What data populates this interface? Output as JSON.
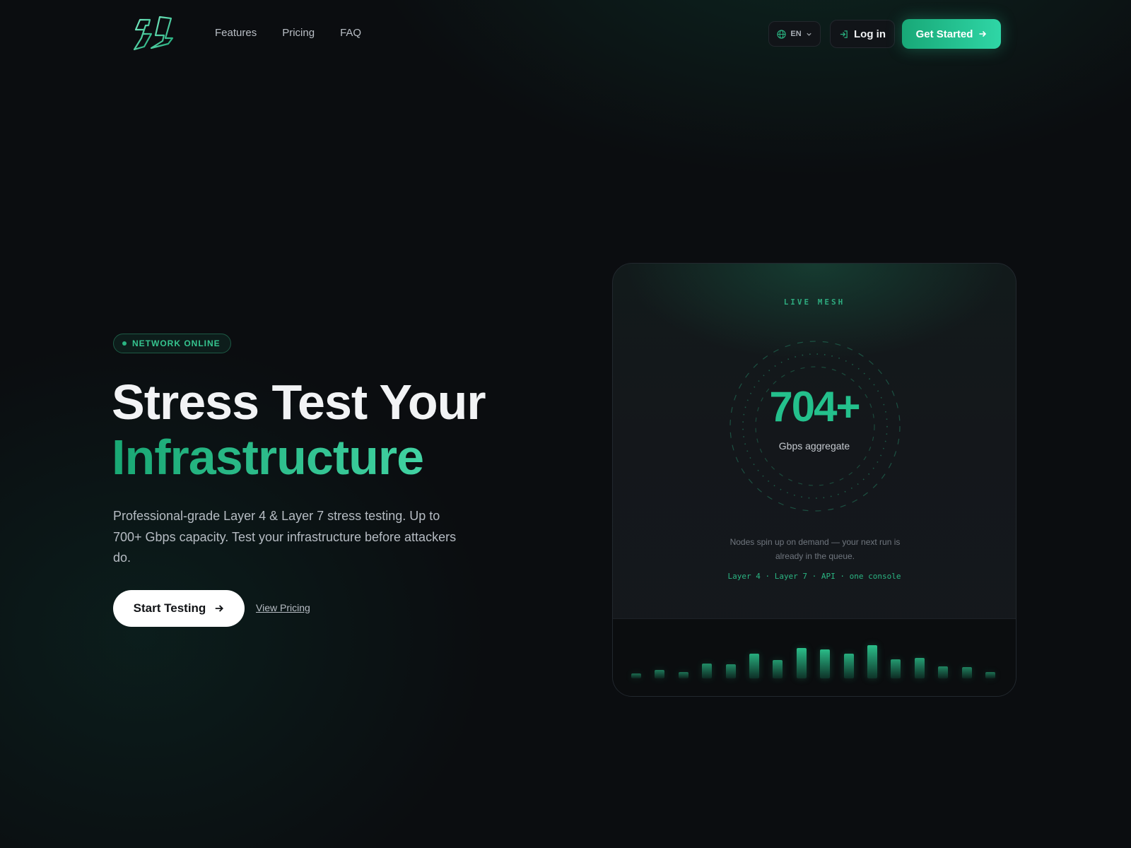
{
  "nav": {
    "links": [
      "Features",
      "Pricing",
      "FAQ"
    ],
    "language": "EN",
    "login_label": "Log in",
    "cta_label": "Get Started"
  },
  "hero": {
    "badge": "NETWORK ONLINE",
    "headline_line1": "Stress Test Your",
    "headline_line2": "Infrastructure",
    "subtext": "Professional-grade Layer 4 & Layer 7 stress testing. Up to 700+ Gbps capacity. Test your infrastructure before attackers do.",
    "primary_cta": "Start Testing",
    "secondary_cta": "View Pricing"
  },
  "card": {
    "title": "LIVE MESH",
    "metric_value": "704+",
    "metric_label": "Gbps aggregate",
    "description": "Nodes spin up on demand — your next run is already in the queue.",
    "tagline": "Layer 4 · Layer 7 · API · one console",
    "bar_levels": [
      0.09,
      0.16,
      0.12,
      0.27,
      0.26,
      0.45,
      0.33,
      0.55,
      0.53,
      0.45,
      0.6,
      0.34,
      0.37,
      0.22,
      0.2,
      0.12
    ]
  },
  "colors": {
    "accent": "#24c08c",
    "accent_light": "#3fd0a0",
    "background": "#0b0d10"
  }
}
